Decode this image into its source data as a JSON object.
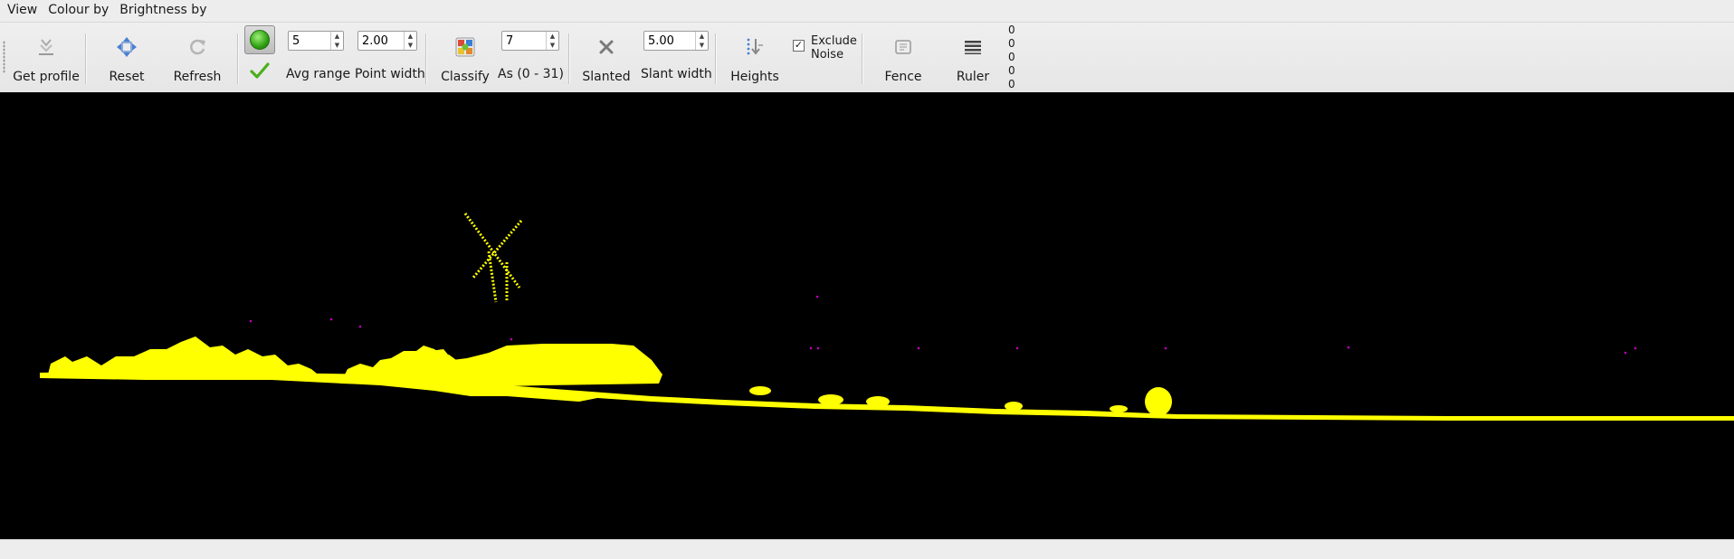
{
  "menu": [
    "View",
    "Colour by",
    "Brightness by"
  ],
  "toolbar": {
    "get_profile": "Get profile",
    "reset": "Reset",
    "refresh": "Refresh",
    "avg_range_value": "5",
    "avg_range_label": "Avg range",
    "point_width_value": "2.00",
    "point_width_label": "Point width",
    "classify": "Classify",
    "classify_as_value": "7",
    "classify_as_label": "As (0 - 31)",
    "slanted": "Slanted",
    "slant_width_value": "5.00",
    "slant_width_label": "Slant width",
    "heights": "Heights",
    "exclude_noise": "Exclude\nNoise",
    "exclude_noise_line1": "Exclude",
    "exclude_noise_line2": "Noise",
    "exclude_noise_checked": true,
    "fence": "Fence",
    "ruler": "Ruler",
    "counts": [
      "0",
      "0",
      "0",
      "0",
      "0"
    ]
  },
  "viewport": {
    "background": "#000000",
    "point_color": "#ffff00",
    "noise_color": "#c000c0"
  }
}
